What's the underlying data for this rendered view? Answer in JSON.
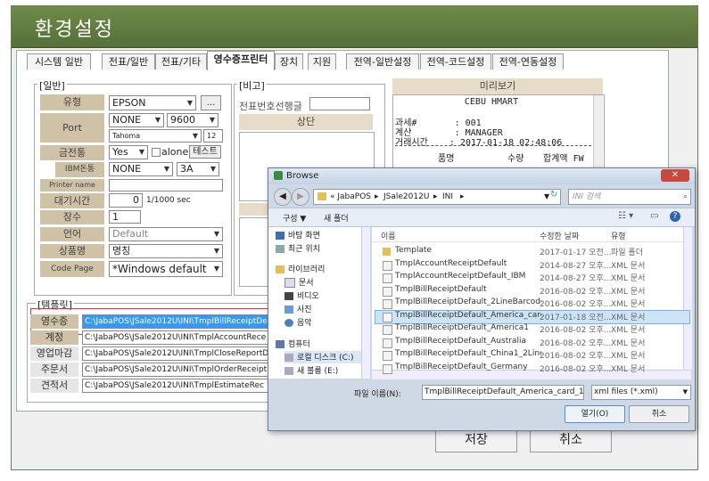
{
  "window": {
    "title": "환경설정"
  },
  "tabs": [
    {
      "label": "시스템 일반"
    },
    {
      "label": "전표/일반"
    },
    {
      "label": "전표/기타"
    },
    {
      "label": "영수증프린터"
    },
    {
      "label": "장치"
    },
    {
      "label": "지원"
    },
    {
      "label": "전역-일반설정"
    },
    {
      "label": "전역-코드설정"
    },
    {
      "label": "전역-연동설정"
    }
  ],
  "general": {
    "legend": "[일반]",
    "type_label": "유형",
    "type_value": "EPSON",
    "type_browse": "...",
    "port_label": "Port",
    "port_value": "NONE",
    "baud_value": "9600",
    "font_value": "Tahoma",
    "font_size": "12",
    "drawer_label": "금전통",
    "drawer_value": "Yes",
    "alone_label": "alone",
    "test_label": "테스트",
    "ibm_label": "IBM돈통",
    "ibm_value": "NONE",
    "ibm_port": "3A",
    "printer_name_label": "Printer name",
    "printer_name_value": "",
    "wait_label": "대기시간",
    "wait_value": "0",
    "wait_unit": "1/1000 sec",
    "copies_label": "장수",
    "copies_value": "1",
    "lang_label": "언어",
    "lang_value": "Default",
    "product_label": "상품명",
    "product_value": "명칭",
    "codepage_label": "Code Page",
    "codepage_value": "*Windows default"
  },
  "remarks": {
    "legend": "[비고]",
    "line_label": "전표번호선행글",
    "line_value": "",
    "top_label": "상단"
  },
  "preview": {
    "title": "미리보기",
    "store": "CEBU HMART",
    "lines": [
      "과세#       : 001",
      "계산        : MANAGER",
      "거래시간    : 2017-01-18 02:48:06"
    ],
    "cols": [
      "품명",
      "수량",
      "합계액 FW"
    ]
  },
  "templates": {
    "legend": "[템플릿]",
    "rows": [
      {
        "label": "영수증",
        "value": "C:\\JabaPOS\\JSale2012U\\INI\\TmplBillReceiptDe"
      },
      {
        "label": "계정",
        "value": "C:\\JabaPOS\\JSale2012U\\INI\\TmplAccountRece"
      },
      {
        "label": "영업마감",
        "value": "C:\\JabaPOS\\JSale2012U\\INI\\TmplCloseReportD"
      },
      {
        "label": "주문서",
        "value": "C:\\JabaPOS\\JSale2012U\\INI\\TmplOrderReceipt"
      },
      {
        "label": "견적서",
        "value": "C:\\JabaPOS\\JSale2012U\\INI\\TmplEstimateRec"
      }
    ]
  },
  "buttons": {
    "save": "저장",
    "cancel": "취소"
  },
  "browse": {
    "title": "Browse",
    "path": [
      "«  JabaPOS",
      "JSale2012U",
      "INI"
    ],
    "search_placeholder": "INI 검색",
    "organize": "구성 ▼",
    "new_folder": "새 폴더",
    "nav": [
      {
        "label": "바탕 화면"
      },
      {
        "label": "최근 위치"
      },
      {
        "label": "라이브러리"
      },
      {
        "label": "문서"
      },
      {
        "label": "비디오"
      },
      {
        "label": "사진"
      },
      {
        "label": "음악"
      },
      {
        "label": "컴퓨터"
      },
      {
        "label": "로컬 디스크 (C:)"
      },
      {
        "label": "새 볼륨 (E:)"
      }
    ],
    "headers": [
      "이름",
      "수정한 날짜",
      "유형"
    ],
    "files": [
      {
        "name": "Template",
        "date": "2017-01-17 오전...",
        "type": "파일 폴더",
        "folder": true
      },
      {
        "name": "TmplAccountReceiptDefault",
        "date": "2014-08-27 오후...",
        "type": "XML 문서"
      },
      {
        "name": "TmplAccountReceiptDefault_IBM",
        "date": "2014-08-27 오후...",
        "type": "XML 문서"
      },
      {
        "name": "TmplBillReceiptDefault",
        "date": "2016-08-02 오후...",
        "type": "XML 문서"
      },
      {
        "name": "TmplBillReceiptDefault_2LineBarcode",
        "date": "2016-08-02 오후...",
        "type": "XML 문서"
      },
      {
        "name": "TmplBillReceiptDefault_America_card_1",
        "date": "2017-01-18 오전...",
        "type": "XML 문서",
        "selected": true
      },
      {
        "name": "TmplBillReceiptDefault_America1",
        "date": "2016-08-02 오후...",
        "type": "XML 문서"
      },
      {
        "name": "TmplBillReceiptDefault_Australia",
        "date": "2016-08-02 오후...",
        "type": "XML 문서"
      },
      {
        "name": "TmplBillReceiptDefault_China1_2Line",
        "date": "2016-08-02 오후...",
        "type": "XML 문서"
      },
      {
        "name": "TmplBillReceiptDefault_Germany",
        "date": "2016-08-02 오후...",
        "type": "XML 문서"
      }
    ],
    "filename_label": "파일 이름(N):",
    "filename_value": "TmplBillReceiptDefault_America_card_1",
    "filter_value": "xml files (*.xml)",
    "open": "열기(O)",
    "cancel": "취소"
  },
  "colors": {
    "title_green": "#5f7c40",
    "label_tan": "#cfc2a6",
    "selection_blue": "#cde4f7",
    "field_blue": "#3399ff"
  }
}
